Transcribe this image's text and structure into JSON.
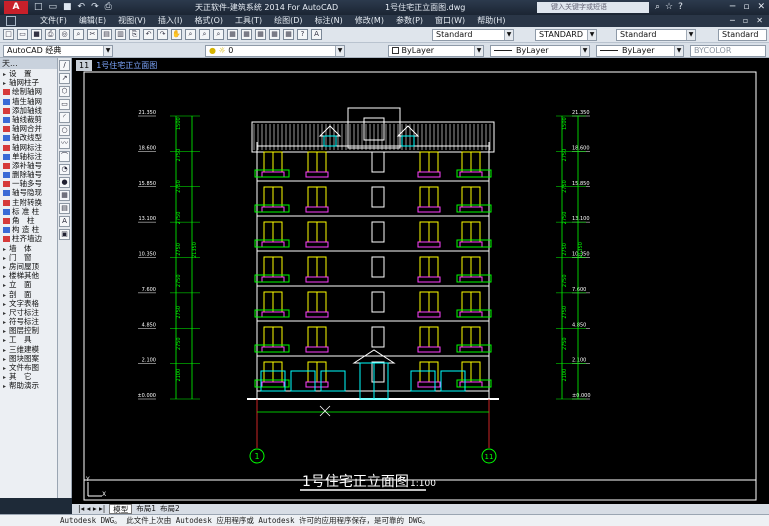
{
  "window": {
    "app_logo": "A",
    "title": "天正软件-建筑系统 2014  For AutoCAD",
    "file_title": "1号住宅正立面图.dwg",
    "search_placeholder": "键入关键字或短语",
    "controls": [
      "─",
      "▫",
      "✕"
    ]
  },
  "menubar": {
    "items": [
      "文件(F)",
      "编辑(E)",
      "视图(V)",
      "插入(I)",
      "格式(O)",
      "工具(T)",
      "绘图(D)",
      "标注(N)",
      "修改(M)",
      "参数(P)",
      "窗口(W)",
      "帮助(H)"
    ],
    "right": [
      "─",
      "▫",
      "✕"
    ]
  },
  "toolbar1": {
    "text_style": "Standard",
    "dim_style": "STANDARD",
    "table_style": "Standard",
    "ml_style": "Standard"
  },
  "toolbar2": {
    "workspace": "AutoCAD 经典",
    "layer": "0",
    "color": "ByLayer",
    "linetype": "ByLayer",
    "lineweight": "ByLayer",
    "plotstyle": "BYCOLOR"
  },
  "palette": {
    "title": "天...",
    "items": [
      {
        "label": "设　置",
        "type": "folder"
      },
      {
        "label": "轴网柱子",
        "type": "folder"
      },
      {
        "label": "绘制轴网",
        "type": "tool",
        "color": "#d63a3a"
      },
      {
        "label": "墙生轴网",
        "type": "tool",
        "color": "#3a6ad6"
      },
      {
        "label": "添加轴线",
        "type": "tool",
        "color": "#d63a3a"
      },
      {
        "label": "轴线裁剪",
        "type": "tool",
        "color": "#3a6ad6"
      },
      {
        "label": "轴网合并",
        "type": "tool",
        "color": "#d63a3a"
      },
      {
        "label": "轴改线型",
        "type": "tool",
        "color": "#3a6ad6"
      },
      {
        "label": "轴网标注",
        "type": "tool",
        "color": "#d63a3a"
      },
      {
        "label": "单轴标注",
        "type": "tool",
        "color": "#3a6ad6"
      },
      {
        "label": "添补轴号",
        "type": "tool",
        "color": "#d63a3a"
      },
      {
        "label": "删除轴号",
        "type": "tool",
        "color": "#3a6ad6"
      },
      {
        "label": "一轴多号",
        "type": "tool",
        "color": "#d63a3a"
      },
      {
        "label": "轴号隐现",
        "type": "tool",
        "color": "#3a6ad6"
      },
      {
        "label": "主附转换",
        "type": "tool",
        "color": "#d63a3a"
      },
      {
        "label": "标 准 柱",
        "type": "tool",
        "color": "#3a6ad6"
      },
      {
        "label": "角　柱",
        "type": "tool",
        "color": "#d63a3a"
      },
      {
        "label": "构 造 柱",
        "type": "tool",
        "color": "#3a6ad6"
      },
      {
        "label": "柱齐墙边",
        "type": "tool",
        "color": "#d63a3a"
      },
      {
        "label": "墙　体",
        "type": "folder"
      },
      {
        "label": "门　窗",
        "type": "folder"
      },
      {
        "label": "房间屋顶",
        "type": "folder"
      },
      {
        "label": "楼梯其他",
        "type": "folder"
      },
      {
        "label": "立　面",
        "type": "folder"
      },
      {
        "label": "剖　面",
        "type": "folder"
      },
      {
        "label": "文字表格",
        "type": "folder"
      },
      {
        "label": "尺寸标注",
        "type": "folder"
      },
      {
        "label": "符号标注",
        "type": "folder"
      },
      {
        "label": "图层控制",
        "type": "folder"
      },
      {
        "label": "工　具",
        "type": "folder"
      },
      {
        "label": "三维建模",
        "type": "folder"
      },
      {
        "label": "图块图案",
        "type": "folder"
      },
      {
        "label": "文件布图",
        "type": "folder"
      },
      {
        "label": "其　它",
        "type": "folder"
      },
      {
        "label": "帮助演示",
        "type": "folder"
      }
    ]
  },
  "drawing": {
    "tab_number": "11",
    "tab_name": "1号住宅正立面图",
    "title": "1号住宅正立面图",
    "scale": "1:100",
    "axis_left": "1",
    "axis_right": "11",
    "elevations": [
      "21.350",
      "18.600",
      "15.850",
      "13.100",
      "10.350",
      "7.600",
      "4.850",
      "2.100",
      "±0.000"
    ],
    "dims_inner": [
      "1500",
      "2750",
      "2750",
      "2750",
      "2750",
      "2750",
      "2750",
      "2750",
      "2100"
    ],
    "dims_outer": [
      "21350",
      "2750",
      "2750",
      "2750",
      "2750",
      "2750",
      "2750",
      "2750",
      "2100"
    ],
    "colors": {
      "white": "#ffffff",
      "yellow": "#ffff00",
      "green": "#00ff00",
      "cyan": "#00ffff",
      "red": "#ff3030",
      "magenta": "#ff40ff"
    }
  },
  "layout_tabs": [
    "模型",
    "布局1",
    "布局2"
  ],
  "command_line": "Autodesk DWG。  此文件上次由 Autodesk 应用程序或 Autodesk 许可的应用程序保存，是可靠的 DWG。"
}
